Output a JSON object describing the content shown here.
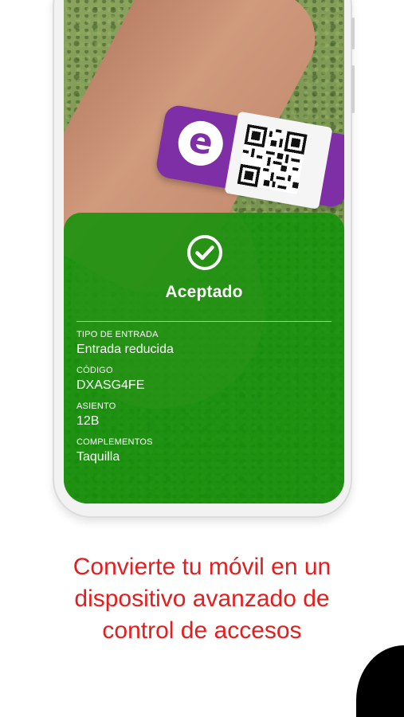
{
  "result": {
    "status": "Aceptado",
    "fields": [
      {
        "label": "TIPO DE ENTRADA",
        "value": "Entrada reducida"
      },
      {
        "label": "CÓDIGO",
        "value": "DXASG4FE"
      },
      {
        "label": "ASIENTO",
        "value": "12B"
      },
      {
        "label": "COMPLEMENTOS",
        "value": "Taquilla"
      }
    ]
  },
  "wristband": {
    "logo": "e"
  },
  "tagline": [
    "Convierte tu móvil en un",
    "dispositivo avanzado de",
    "control de accesos"
  ],
  "icons": {
    "status": "check-circle-icon",
    "code": "qr-code-icon"
  },
  "colors": {
    "accepted": "#109108",
    "tagline": "#e41e1e",
    "band": "#7e2fa6"
  }
}
